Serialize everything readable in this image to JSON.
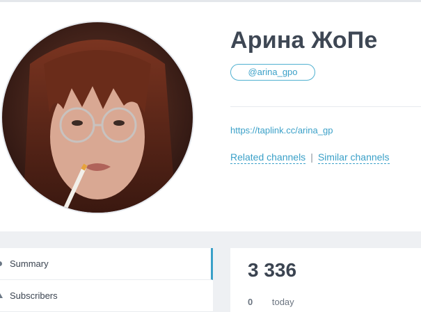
{
  "channel": {
    "title": "Арина ЖоПе",
    "handle": "@arina_gpo",
    "link": "https://taplink.cc/arina_gp",
    "related_label": "Related channels",
    "separator": "|",
    "similar_label": "Similar channels"
  },
  "sidebar": {
    "items": [
      {
        "label": "Summary",
        "icon": "summary-icon",
        "active": true
      },
      {
        "label": "Subscribers",
        "icon": "subscribers-icon",
        "active": false
      }
    ]
  },
  "stats": {
    "subscribers_total": "3 336",
    "today_value": "0",
    "today_label": "today"
  },
  "colors": {
    "accent": "#3aa0c8",
    "title": "#3e4754",
    "background": "#eef0f3",
    "card": "#ffffff"
  }
}
